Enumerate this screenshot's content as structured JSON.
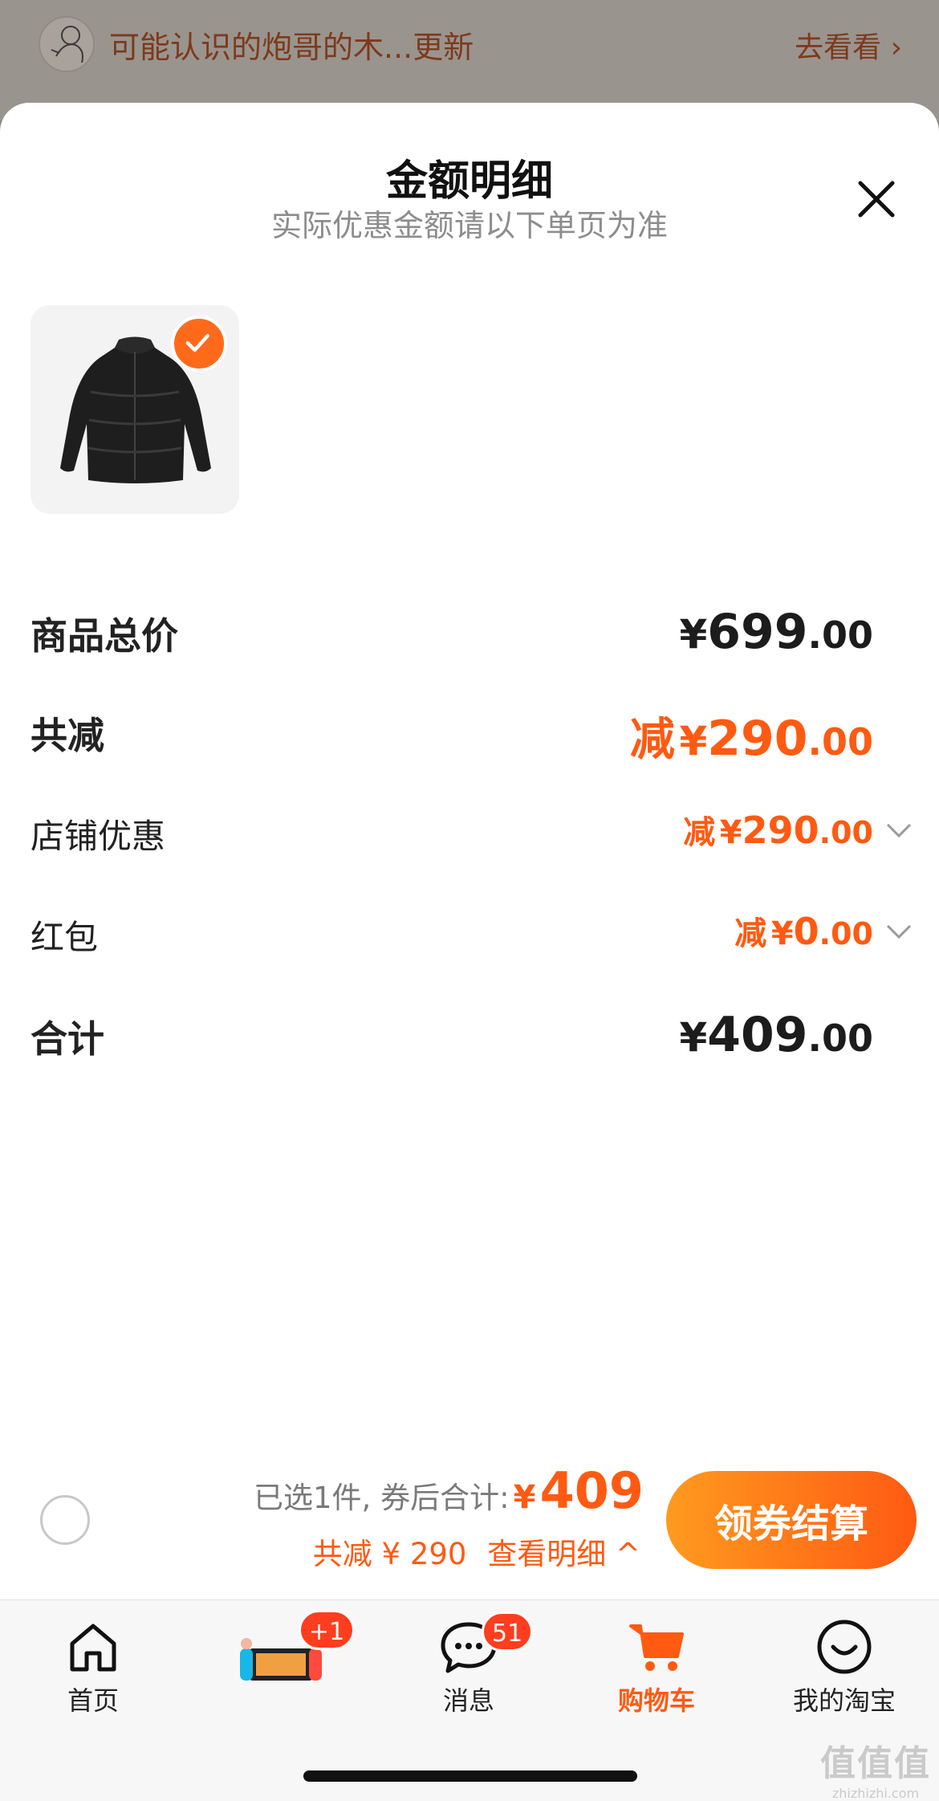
{
  "banner": {
    "text": "可能认识的炮哥的木...更新",
    "action": "去看看 ›"
  },
  "sheet": {
    "title": "金额明细",
    "subtitle": "实际优惠金额请以下单页为准"
  },
  "rows": {
    "total_price": {
      "label": "商品总价",
      "yen": "¥",
      "int": "699",
      "dec": ".00"
    },
    "total_discount": {
      "label": "共减",
      "prefix": "减",
      "yen": "¥",
      "int": "290",
      "dec": ".00"
    },
    "shop_coupon": {
      "label": "店铺优惠",
      "prefix": "减",
      "yen": "¥",
      "int": "290",
      "dec": ".00"
    },
    "red_packet": {
      "label": "红包",
      "prefix": "减",
      "yen": "¥",
      "int": "0",
      "dec": ".00"
    },
    "sum": {
      "label": "合计",
      "yen": "¥",
      "int": "409",
      "dec": ".00"
    }
  },
  "checkout": {
    "selected_text": "已选1件, 券后合计:",
    "yen": "¥",
    "total": "409",
    "discount_text": "共减 ¥ 290",
    "detail_link": "查看明细 ^",
    "button": "领券结算"
  },
  "tabbar": {
    "home": "首页",
    "promo_badge": "+1",
    "messages": "消息",
    "messages_badge": "51",
    "cart": "购物车",
    "mine": "我的淘宝"
  },
  "watermark": {
    "main": "值值值",
    "sub": "zhizhizhi.com"
  },
  "colors": {
    "accent": "#ff5a12",
    "button_start": "#ff9a1f",
    "button_end": "#ff5a12"
  }
}
